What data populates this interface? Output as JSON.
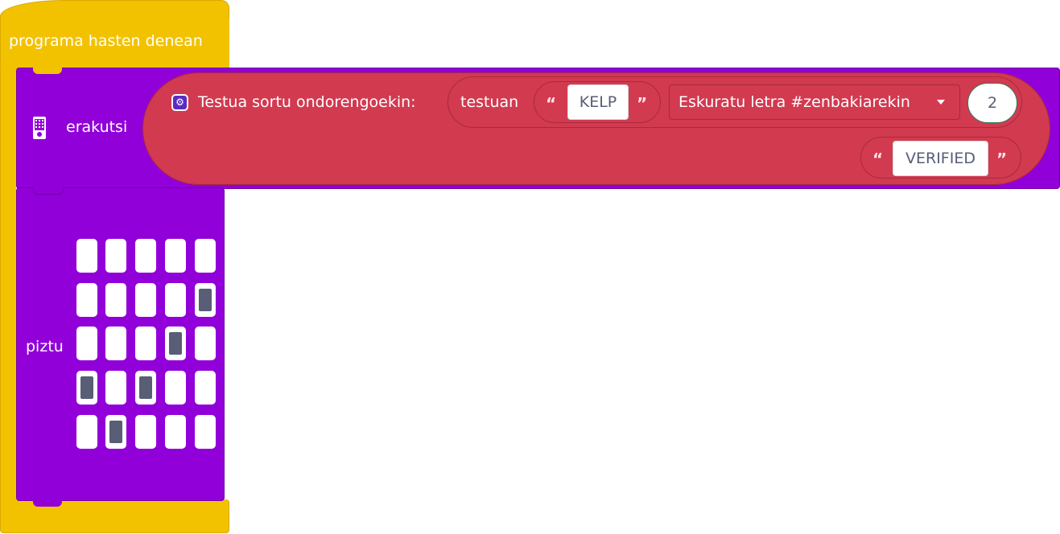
{
  "event_block": {
    "label": "programa hasten denean"
  },
  "show_block": {
    "label": "erakutsi",
    "icon": "led-display-icon"
  },
  "join_block": {
    "label": "Testua sortu ondorengoekin:",
    "icon": "gear-icon",
    "in_text_label": "testuan",
    "text_value": "KELP",
    "dropdown_label": "Eskuratu letra #zenbakiarekin",
    "index_value": "2",
    "second_text_value": "VERIFIED",
    "open_quote": "“",
    "close_quote": "”"
  },
  "led_block": {
    "label": "piztu",
    "grid": [
      [
        0,
        0,
        0,
        0,
        0
      ],
      [
        0,
        0,
        0,
        0,
        1
      ],
      [
        0,
        0,
        0,
        1,
        0
      ],
      [
        1,
        0,
        1,
        0,
        0
      ],
      [
        0,
        1,
        0,
        0,
        0
      ]
    ]
  },
  "colors": {
    "event": "#f2c200",
    "basic": "#9200d9",
    "text": "#d23a50",
    "led_on": "#575e75"
  }
}
